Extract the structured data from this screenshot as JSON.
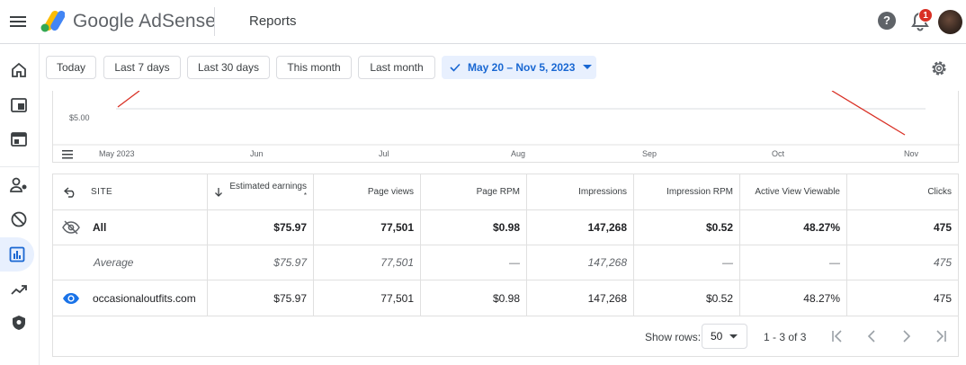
{
  "app": {
    "brand": "Google AdSense",
    "page_title": "Reports"
  },
  "header": {
    "notification_count": "1",
    "help_glyph": "?",
    "icons": [
      "menu-icon",
      "adsense-logo",
      "help-icon",
      "bell-icon",
      "avatar"
    ]
  },
  "sidebar": {
    "items": [
      {
        "name": "home-icon"
      },
      {
        "name": "ads-icon"
      },
      {
        "name": "sites-icon"
      },
      {
        "name": "account-icon"
      },
      {
        "name": "block-icon"
      },
      {
        "name": "reports-icon",
        "active": true
      },
      {
        "name": "optimization-icon"
      },
      {
        "name": "privacy-icon"
      }
    ]
  },
  "filters": {
    "today": "Today",
    "last7": "Last 7 days",
    "last30": "Last 30 days",
    "this_month": "This month",
    "last_month": "Last month",
    "date_range": "May 20 – Nov 5, 2023"
  },
  "chart_data": {
    "type": "line",
    "y_tick_labels": [
      "$5.00"
    ],
    "x_tick_labels": [
      "May 2023",
      "Jun",
      "Jul",
      "Aug",
      "Sep",
      "Oct",
      "Nov"
    ],
    "grid": true,
    "visible_series_color": "#d93025",
    "series": [
      {
        "values_visible": "partial (chart clipped; only line fragments visible near May and Oct–Nov)"
      }
    ]
  },
  "table": {
    "columns": [
      "SITE",
      "Estimated earnings",
      "Page views",
      "Page RPM",
      "Impressions",
      "Impression RPM",
      "Active View Viewable",
      "Clicks"
    ],
    "sort_marker": "*",
    "rows": [
      {
        "site": "All",
        "earnings": "$75.97",
        "page_views": "77,501",
        "page_rpm": "$0.98",
        "impressions": "147,268",
        "impression_rpm": "$0.52",
        "active_view": "48.27%",
        "clicks": "475"
      },
      {
        "site": "Average",
        "earnings": "$75.97",
        "page_views": "77,501",
        "page_rpm": "—",
        "impressions": "147,268",
        "impression_rpm": "—",
        "active_view": "—",
        "clicks": "475"
      },
      {
        "site": "occasionaloutfits.com",
        "earnings": "$75.97",
        "page_views": "77,501",
        "page_rpm": "$0.98",
        "impressions": "147,268",
        "impression_rpm": "$0.52",
        "active_view": "48.27%",
        "clicks": "475"
      }
    ]
  },
  "pagination": {
    "show_rows_label": "Show rows:",
    "rows_value": "50",
    "range": "1 - 3 of 3"
  },
  "colors": {
    "accent": "#1a73e8",
    "selected_chip_bg": "#e8f0fe",
    "chart_line": "#d93025",
    "badge": "#d93025"
  }
}
